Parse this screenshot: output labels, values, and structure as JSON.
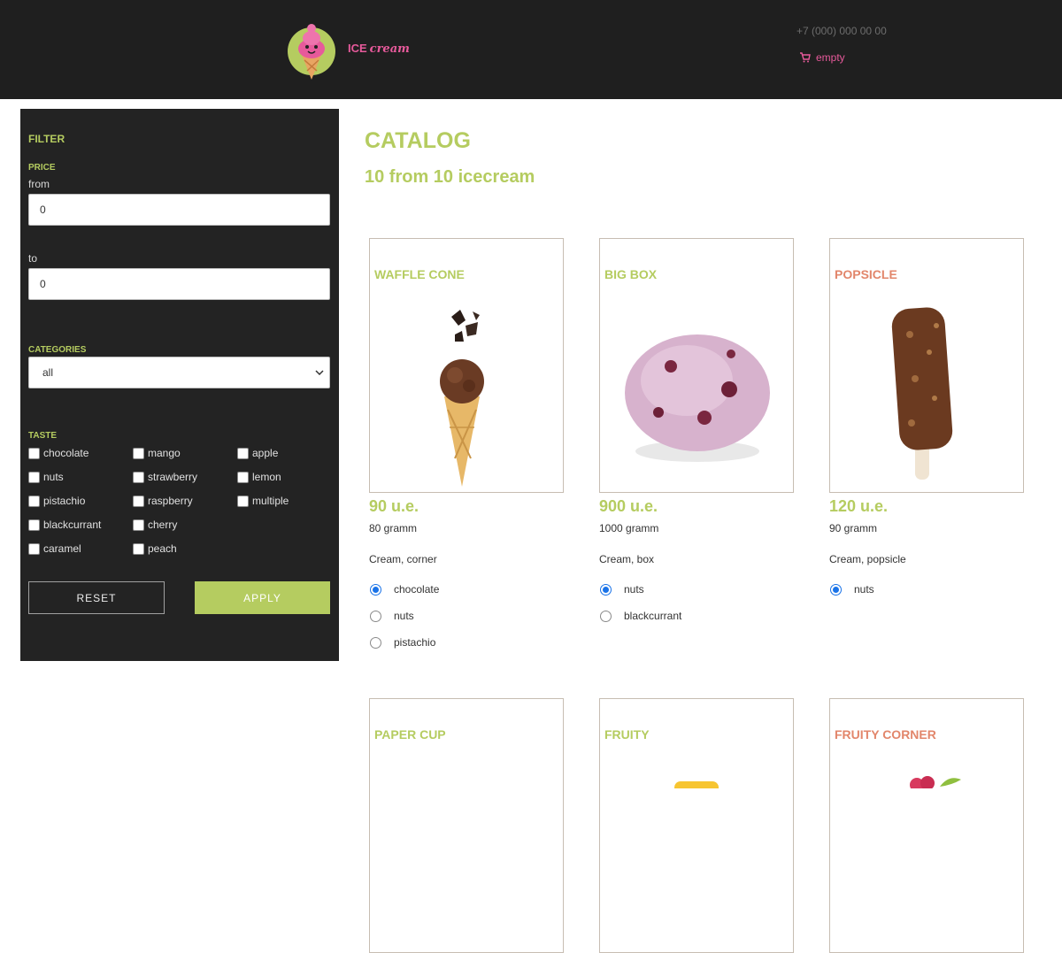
{
  "header": {
    "brand_main": "ICE",
    "brand_sub": "cream",
    "phone": "+7 (000) 000 00 00",
    "cart_status": "empty",
    "colors": {
      "background": "#1f1f1f",
      "brand_pink": "#e75a9b"
    }
  },
  "filter": {
    "title": "FILTER",
    "price_label": "PRICE",
    "from_label": "from",
    "from_value": "0",
    "to_label": "to",
    "to_value": "0",
    "categories_label": "CATEGORIES",
    "category_selected": "all",
    "taste_label": "TASTE",
    "tastes": [
      "chocolate",
      "mango",
      "apple",
      "nuts",
      "strawberry",
      "lemon",
      "pistachio",
      "raspberry",
      "multiple",
      "blackcurrant",
      "cherry",
      "",
      "caramel",
      "peach",
      ""
    ],
    "reset_label": "RESET",
    "apply_label": "APPLY",
    "colors": {
      "panel": "#232323",
      "accent": "#b5cc60"
    }
  },
  "catalog": {
    "title": "CATALOG",
    "count_text": "10 from 10 icecream",
    "products": [
      {
        "name": "WAFFLE CONE",
        "price": "90 u.e.",
        "weight": "80 gramm",
        "description": "Cream, corner",
        "options": [
          "chocolate",
          "nuts",
          "pistachio"
        ],
        "selected_option": "chocolate",
        "name_color": "#b5cc60",
        "image": "waffle-cone-icon"
      },
      {
        "name": "BIG BOX",
        "price": "900 u.e.",
        "weight": "1000 gramm",
        "description": "Cream, box",
        "options": [
          "nuts",
          "blackcurrant"
        ],
        "selected_option": "nuts",
        "name_color": "#b5cc60",
        "image": "ice-cream-scoop-icon"
      },
      {
        "name": "POPSICLE",
        "price": "120 u.e.",
        "weight": "90 gramm",
        "description": "Cream, popsicle",
        "options": [
          "nuts"
        ],
        "selected_option": "nuts",
        "name_color": "#e2866b",
        "image": "popsicle-icon"
      },
      {
        "name": "PAPER CUP",
        "name_color": "#b5cc60"
      },
      {
        "name": "FRUITY",
        "name_color": "#b5cc60"
      },
      {
        "name": "FRUITY CORNER",
        "name_color": "#e2866b"
      }
    ]
  }
}
